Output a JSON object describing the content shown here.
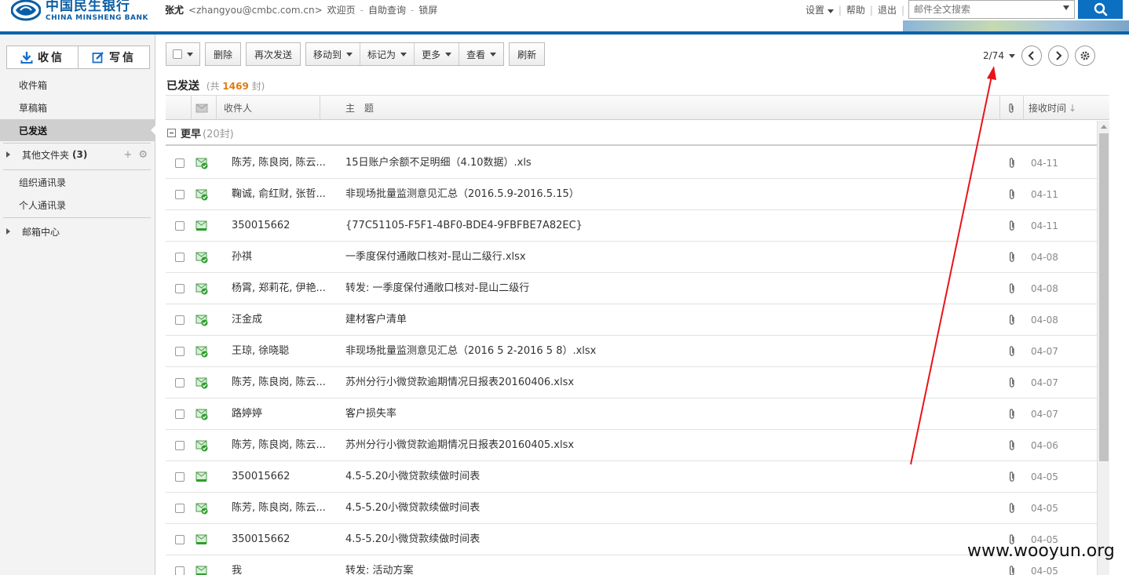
{
  "header": {
    "bank_cn": "中国民生银行",
    "bank_en": "CHINA MINSHENG BANK",
    "user_name": "张尤",
    "user_email": "<zhangyou@cmbc.com.cn>",
    "links": [
      "欢迎页",
      "自助查询",
      "锁屏"
    ],
    "settings_label": "设置",
    "help_label": "帮助",
    "logout_label": "退出",
    "search_placeholder": "邮件全文搜索",
    "accent_color": "#0b63a9"
  },
  "sidebar": {
    "receive_label": "收信",
    "compose_label": "写信",
    "folders": {
      "inbox": "收件箱",
      "drafts": "草稿箱",
      "sent": "已发送",
      "other": "其他文件夹",
      "other_count": "(3)",
      "org_contacts": "组织通讯录",
      "personal_contacts": "个人通讯录",
      "mail_center": "邮箱中心"
    }
  },
  "toolbar": {
    "delete": "删除",
    "resend": "再次发送",
    "move_to": "移动到",
    "mark_as": "标记为",
    "more": "更多",
    "view": "查看",
    "refresh": "刷新"
  },
  "pager": {
    "page": "2/74"
  },
  "folder_title": {
    "name": "已发送",
    "prefix": "(共",
    "count": "1469",
    "suffix": "封)"
  },
  "columns": {
    "recipient": "收件人",
    "subject": "主　题",
    "received_time": "接收时间"
  },
  "group": {
    "name": "更早",
    "count": "(20封)"
  },
  "rows": [
    {
      "recipient": "陈芳, 陈良岗, 陈云...",
      "subject": "15日账户余额不足明细（4.10数据）.xls",
      "date": "04-11",
      "icon": "sent-mail-icon"
    },
    {
      "recipient": "鞠诚, 俞红财, 张哲...",
      "subject": "非现场批量监测意见汇总（2016.5.9-2016.5.15）",
      "date": "04-11",
      "icon": "sent-mail-icon"
    },
    {
      "recipient": "350015662",
      "subject": "{77C51105-F5F1-4BF0-BDE4-9FBFBE7A82EC}",
      "date": "04-11",
      "icon": "mail-icon"
    },
    {
      "recipient": "孙祺",
      "subject": "一季度保付通敞口核对-昆山二级行.xlsx",
      "date": "04-08",
      "icon": "sent-mail-icon"
    },
    {
      "recipient": "杨霄, 郑莉花, 伊艳...",
      "subject": "转发: 一季度保付通敞口核对-昆山二级行",
      "date": "04-08",
      "icon": "sent-mail-icon"
    },
    {
      "recipient": "汪金成",
      "subject": "建材客户清单",
      "date": "04-08",
      "icon": "sent-mail-icon"
    },
    {
      "recipient": "王琼, 徐晓聪",
      "subject": "非现场批量监测意见汇总（2016 5 2-2016 5 8）.xlsx",
      "date": "04-07",
      "icon": "sent-mail-icon"
    },
    {
      "recipient": "陈芳, 陈良岗, 陈云...",
      "subject": "苏州分行小微贷款逾期情况日报表20160406.xlsx",
      "date": "04-07",
      "icon": "sent-mail-icon"
    },
    {
      "recipient": "路婷婷",
      "subject": "客户损失率",
      "date": "04-07",
      "icon": "sent-mail-icon"
    },
    {
      "recipient": "陈芳, 陈良岗, 陈云...",
      "subject": "苏州分行小微贷款逾期情况日报表20160405.xlsx",
      "date": "04-06",
      "icon": "sent-mail-icon"
    },
    {
      "recipient": "350015662",
      "subject": "4.5-5.20小微贷款续做时间表",
      "date": "04-05",
      "icon": "mail-icon"
    },
    {
      "recipient": "陈芳, 陈良岗, 陈云...",
      "subject": "4.5-5.20小微贷款续做时间表",
      "date": "04-05",
      "icon": "sent-mail-icon"
    },
    {
      "recipient": "350015662",
      "subject": "4.5-5.20小微贷款续做时间表",
      "date": "04-05",
      "icon": "mail-icon"
    },
    {
      "recipient": "我",
      "subject": "转发: 活动方案",
      "date": "04-05",
      "icon": "mail-icon"
    }
  ],
  "watermark": "www.wooyun.org",
  "annotation_color": "#e8141a"
}
